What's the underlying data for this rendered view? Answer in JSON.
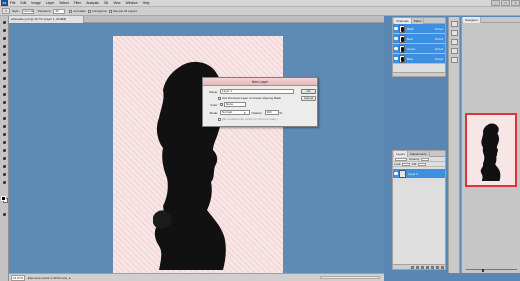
{
  "menubar": {
    "logo": "Ps",
    "items": [
      "File",
      "Edit",
      "Image",
      "Layer",
      "Select",
      "Filter",
      "Analysis",
      "3D",
      "View",
      "Window",
      "Help"
    ],
    "window_buttons": [
      "_",
      "□",
      "×"
    ]
  },
  "options_bar": {
    "style_label": "Style:",
    "style_value": "Normal",
    "tolerance_label": "Tolerance:",
    "tolerance_value": "32",
    "antialias_label": "Anti-alias",
    "contiguous_label": "Contiguous",
    "sample_label": "Sample All Layers"
  },
  "document": {
    "tab_title": "silhouette.psd @ 16.7% (Layer 1, RGB/8)",
    "zoom": "16.67%",
    "info": "Exposure works in 32-bit only",
    "silhouette_color": "#111111",
    "paper_color": "#f8e6e6"
  },
  "dialog": {
    "title": "New Layer",
    "name_label": "Name:",
    "name_value": "Layer 1",
    "clip_label": "Use Previous Layer to Create Clipping Mask",
    "color_label": "Color:",
    "color_value": "None",
    "mode_label": "Mode:",
    "mode_value": "Normal",
    "opacity_label": "Opacity:",
    "opacity_value": "100",
    "opacity_unit": "%",
    "neutral_label": "(No neutral color exists for Normal mode.)",
    "ok_label": "OK",
    "cancel_label": "Cancel"
  },
  "channels": {
    "tabs": [
      "Channels",
      "Paths"
    ],
    "rows": [
      {
        "name": "RGB",
        "key": "Ctrl+2"
      },
      {
        "name": "Red",
        "key": "Ctrl+3"
      },
      {
        "name": "Green",
        "key": "Ctrl+4"
      },
      {
        "name": "Blue",
        "key": "Ctrl+5"
      }
    ],
    "highlight_color": "#3d8fe0"
  },
  "layers": {
    "tabs": [
      "Layers",
      "Adjustments"
    ],
    "blend_label": "Normal",
    "opacity_label": "Opacity:",
    "lock_label": "Lock:",
    "fill_label": "Fill:",
    "rows": [
      {
        "name": "Layer 0"
      }
    ]
  },
  "navigator": {
    "tab": "Navigator",
    "view_box_color": "#e03434"
  }
}
